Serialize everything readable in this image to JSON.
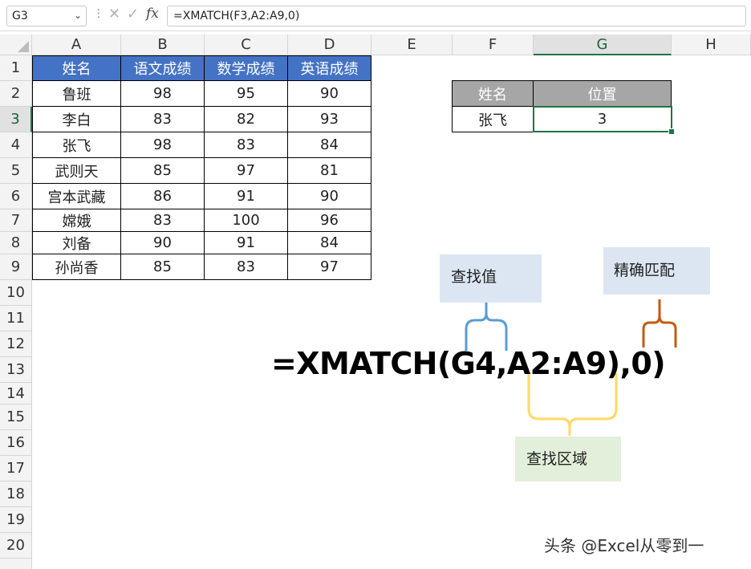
{
  "name_box": {
    "value": "G3"
  },
  "formula_bar": {
    "fx_label": "fx",
    "formula": "=XMATCH(F3,A2:A9,0)"
  },
  "columns": [
    "A",
    "B",
    "C",
    "D",
    "E",
    "F",
    "G",
    "H"
  ],
  "selected_column": "G",
  "rows": [
    "1",
    "2",
    "3",
    "4",
    "5",
    "6",
    "7",
    "8",
    "9",
    "10",
    "11",
    "12",
    "13",
    "14",
    "15",
    "16",
    "17",
    "18",
    "19",
    "20"
  ],
  "selected_row": "3",
  "table": {
    "headers": [
      "姓名",
      "语文成绩",
      "数学成绩",
      "英语成绩"
    ],
    "rows": [
      [
        "鲁班",
        "98",
        "95",
        "90"
      ],
      [
        "李白",
        "83",
        "82",
        "93"
      ],
      [
        "张飞",
        "98",
        "83",
        "84"
      ],
      [
        "武则天",
        "85",
        "97",
        "81"
      ],
      [
        "宫本武藏",
        "86",
        "91",
        "90"
      ],
      [
        "嫦娥",
        "83",
        "100",
        "96"
      ],
      [
        "刘备",
        "90",
        "91",
        "84"
      ],
      [
        "孙尚香",
        "85",
        "83",
        "97"
      ]
    ]
  },
  "lookup": {
    "headers": [
      "姓名",
      "位置"
    ],
    "values": [
      "张飞",
      "3"
    ]
  },
  "annotations": {
    "formula": "=XMATCH(G4,A2:A9),0)",
    "lookup_value": "查找值",
    "exact_match": "精确匹配",
    "lookup_range": "查找区域"
  },
  "colors": {
    "table_header": "#4472c4",
    "lookup_header": "#a6a6a6",
    "active_cell": "#217346",
    "brace_lookup_value": "#5b9bd5",
    "brace_exact_match": "#c55a11",
    "brace_lookup_range": "#ffd966"
  },
  "watermark": "头条 @Excel从零到一"
}
